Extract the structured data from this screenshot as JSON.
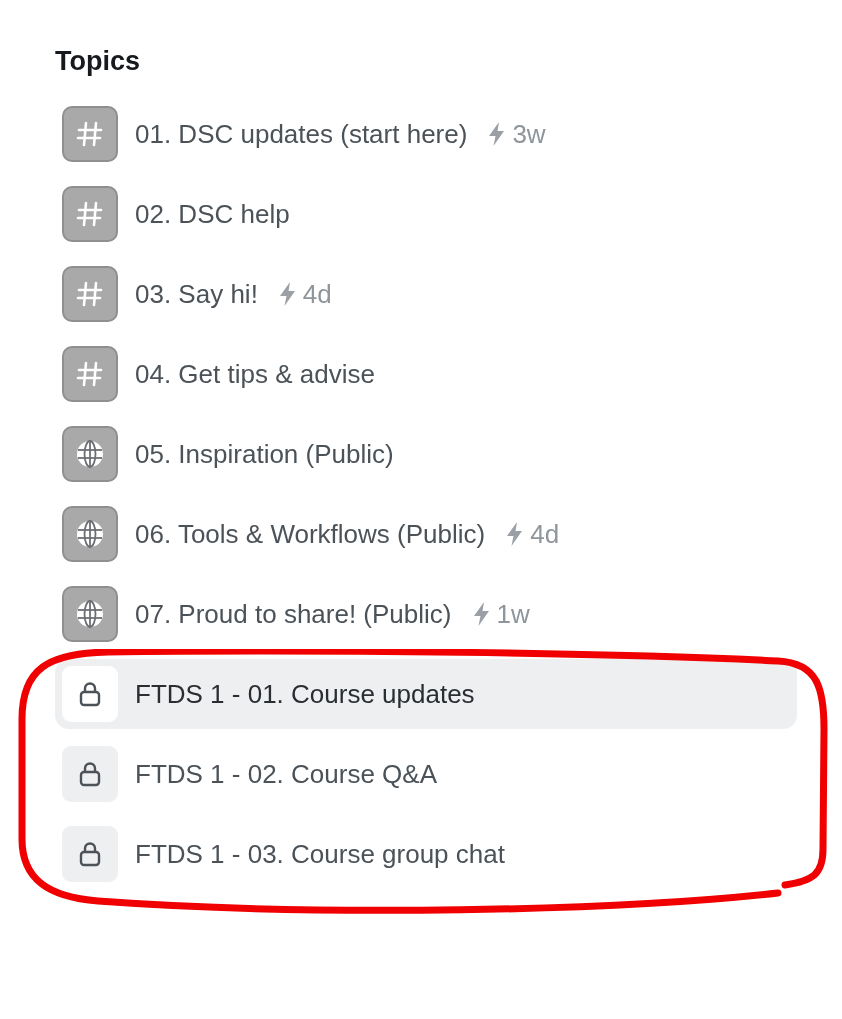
{
  "heading": "Topics",
  "topics": [
    {
      "kind": "hash",
      "label": "01. DSC updates (start here)",
      "activity": "3w",
      "selected": false,
      "circled": false
    },
    {
      "kind": "hash",
      "label": "02. DSC help",
      "selected": false,
      "circled": false
    },
    {
      "kind": "hash",
      "label": "03. Say hi!",
      "activity": "4d",
      "selected": false,
      "circled": false
    },
    {
      "kind": "hash",
      "label": "04. Get tips & advise",
      "selected": false,
      "circled": false
    },
    {
      "kind": "globe",
      "label": "05. Inspiration (Public)",
      "selected": false,
      "circled": false
    },
    {
      "kind": "globe",
      "label": "06. Tools & Workflows (Public)",
      "activity": "4d",
      "selected": false,
      "circled": false
    },
    {
      "kind": "globe",
      "label": "07. Proud to share! (Public)",
      "activity": "1w",
      "selected": false,
      "circled": false
    },
    {
      "kind": "lock",
      "label": "FTDS 1 - 01. Course updates",
      "selected": true,
      "circled": true
    },
    {
      "kind": "lock",
      "label": "FTDS 1 - 02. Course Q&A",
      "selected": false,
      "circled": true
    },
    {
      "kind": "lock",
      "label": "FTDS 1 - 03. Course group chat",
      "selected": false,
      "circled": true
    }
  ]
}
